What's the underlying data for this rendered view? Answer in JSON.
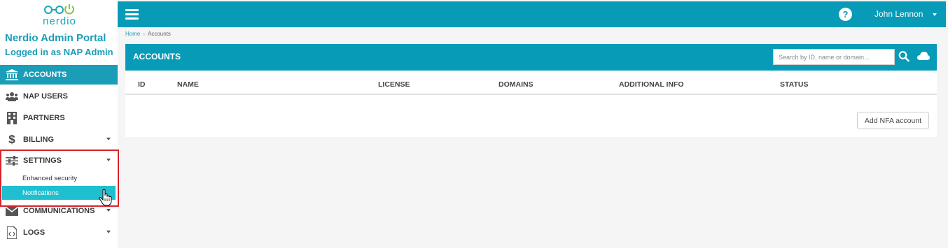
{
  "brand": {
    "logo_text": "nerdio",
    "title": "Nerdio Admin Portal",
    "subtitle": "Logged in as NAP Admin",
    "color": "#1a9db7"
  },
  "sidebar": {
    "items": [
      {
        "label": "ACCOUNTS",
        "icon": "bank-icon",
        "active": true
      },
      {
        "label": "NAP USERS",
        "icon": "users-icon"
      },
      {
        "label": "PARTNERS",
        "icon": "building-icon"
      },
      {
        "label": "BILLING",
        "icon": "dollar-icon",
        "expandable": true
      },
      {
        "label": "SETTINGS",
        "icon": "sliders-icon",
        "expandable": true,
        "children": [
          {
            "label": "Enhanced security"
          },
          {
            "label": "Notifications",
            "active": true
          }
        ]
      },
      {
        "label": "COMMUNICATIONS",
        "icon": "envelope-icon",
        "expandable": true
      },
      {
        "label": "LOGS",
        "icon": "code-file-icon",
        "expandable": true
      }
    ]
  },
  "topbar": {
    "user_name": "John Lennon",
    "help_label": "?"
  },
  "breadcrumb": {
    "home": "Home",
    "separator": "›",
    "current": "Accounts"
  },
  "panel": {
    "title": "ACCOUNTS",
    "search_placeholder": "Search by ID, name or domain...",
    "columns": [
      "ID",
      "NAME",
      "LICENSE",
      "DOMAINS",
      "ADDITIONAL INFO",
      "STATUS"
    ],
    "add_button": "Add NFA account"
  },
  "colors": {
    "header": "#079bb8",
    "active_nav": "#1a9db7",
    "active_sub": "#1fbfd0",
    "highlight": "#d9232b"
  }
}
